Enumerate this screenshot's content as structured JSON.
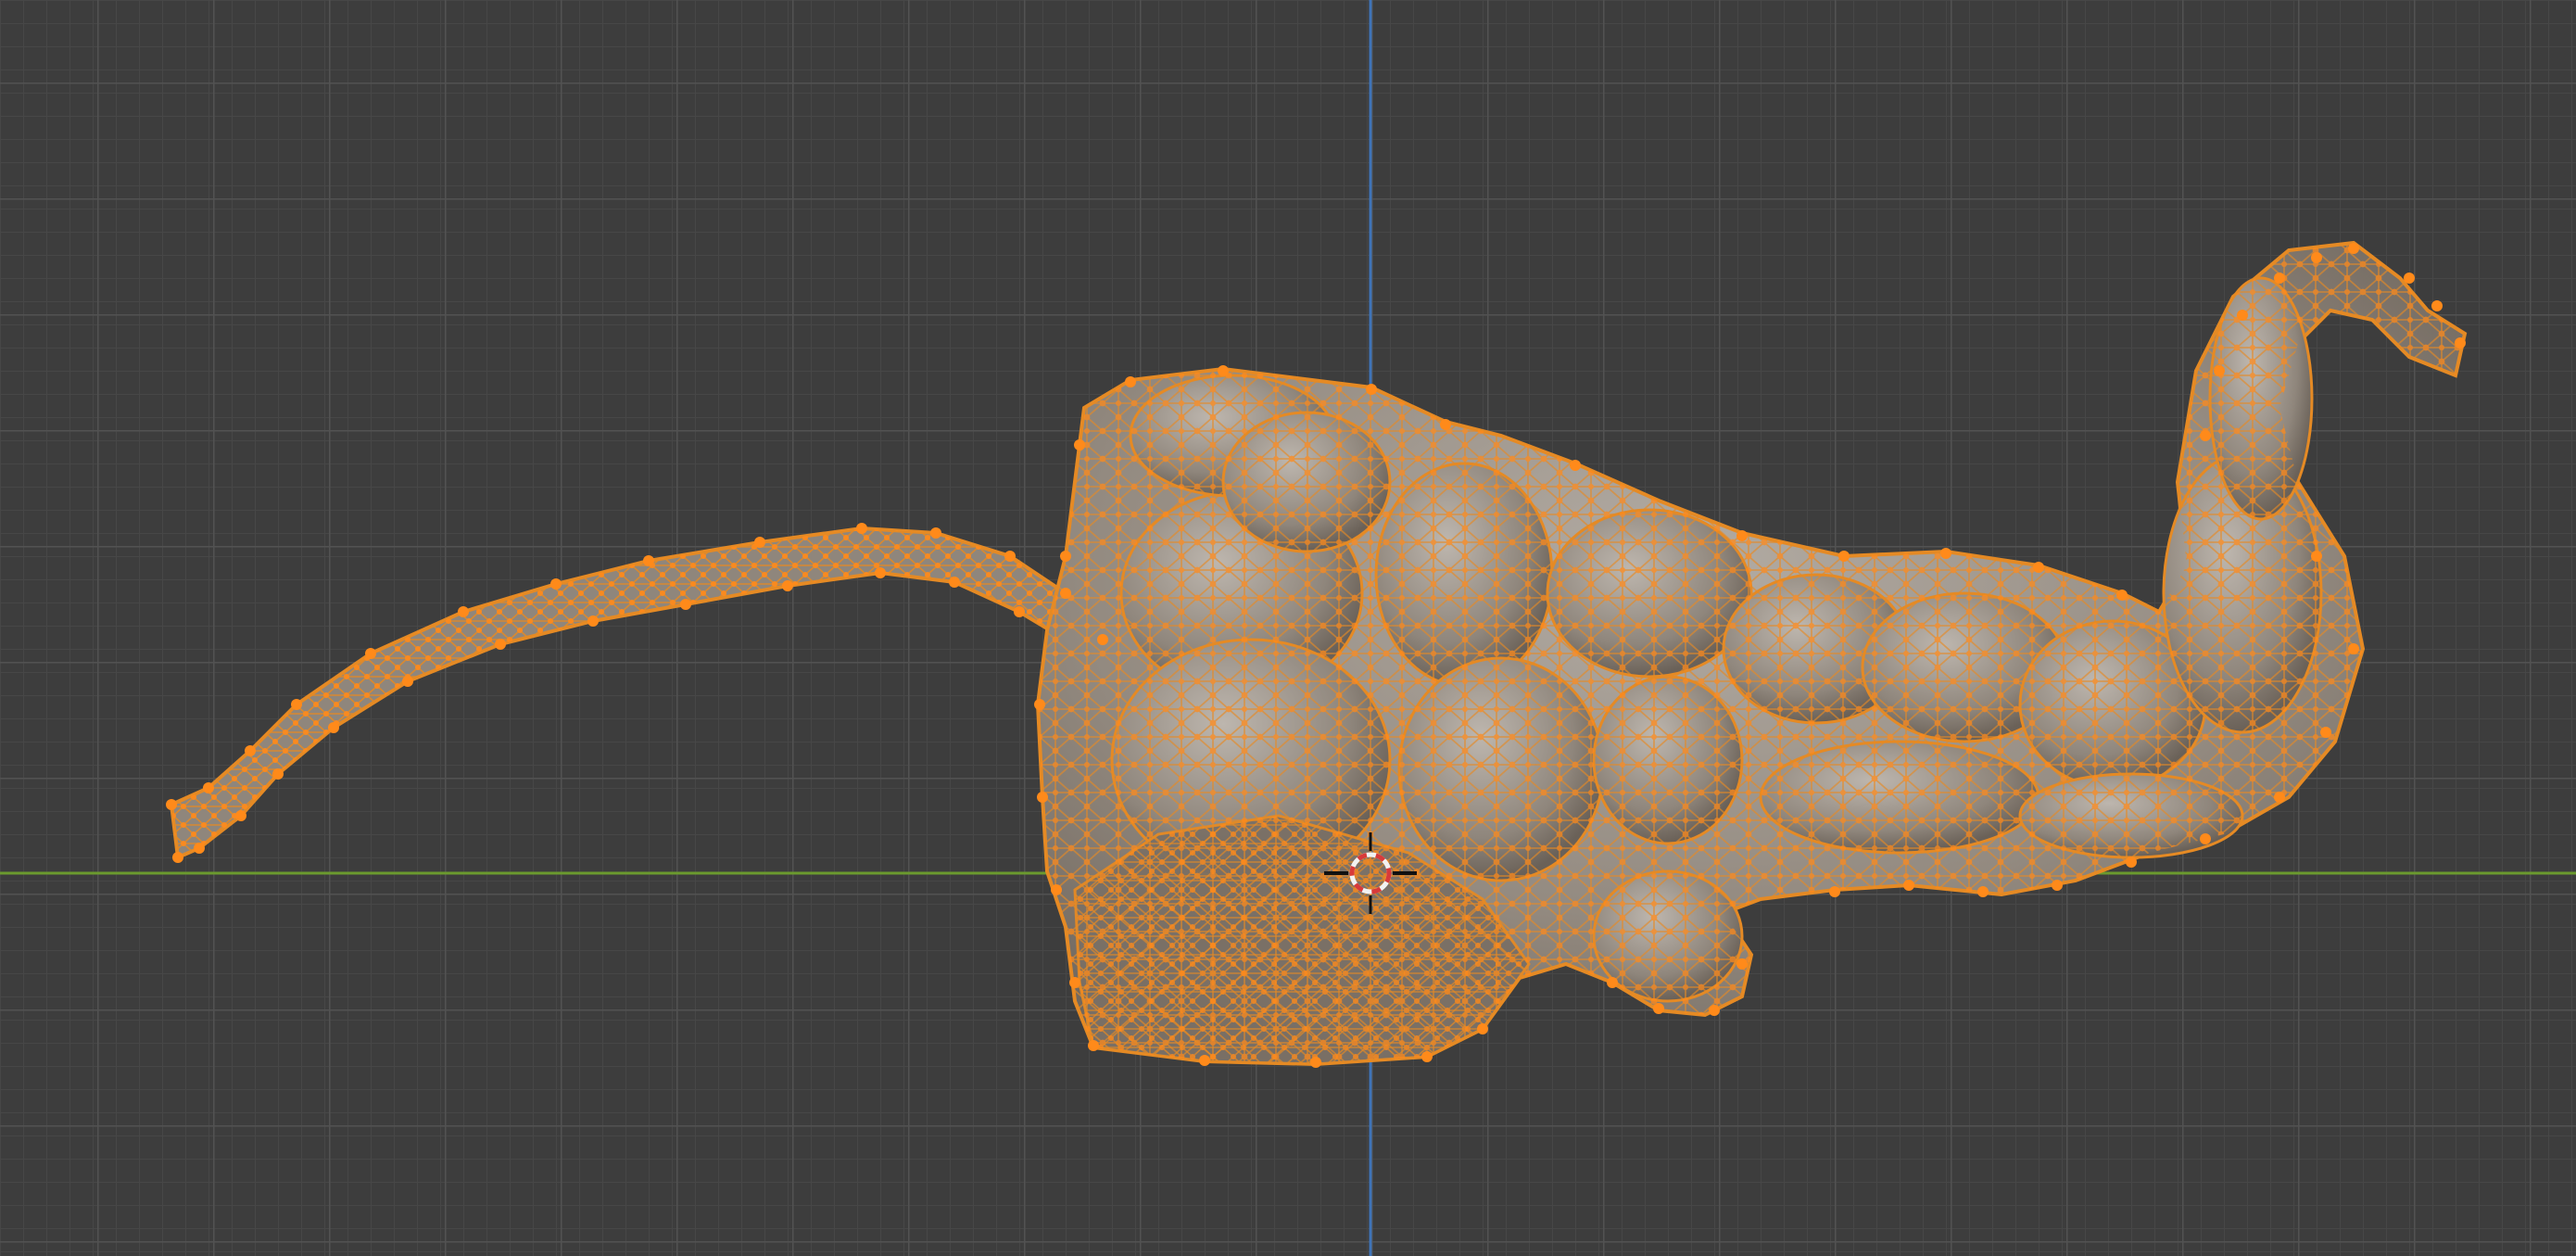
{
  "viewport": {
    "mode": "edit-mode",
    "view": "front-orthographic",
    "mesh_description": "stomach-and-intestines",
    "shading": "solid",
    "selection": "all-vertices-selected"
  },
  "colors": {
    "background": "#3d3d3d",
    "grid_minor": "#474747",
    "grid_major": "#525252",
    "x_axis": "#6b9a2e",
    "z_axis": "#3f74b8",
    "mesh_fill": "#9a9288",
    "mesh_shadow": "#6f655c",
    "wire": "#e58a24",
    "vertex": "#ff8a1a",
    "cursor_red": "#d83a3a",
    "cursor_white": "#f2f2f2"
  }
}
